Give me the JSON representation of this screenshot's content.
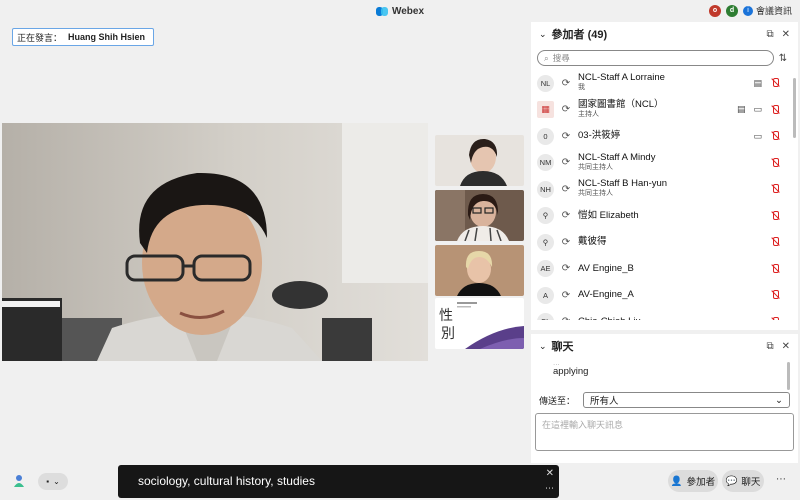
{
  "window": {
    "title": "Webex",
    "meeting_info": "會議資訊",
    "badges": [
      {
        "text": "o",
        "color": "#c0392b"
      },
      {
        "text": "d",
        "color": "#2e7d32"
      }
    ]
  },
  "speaking": {
    "label": "正在發言：",
    "name": "Huang Shih Hsien"
  },
  "participants": {
    "title": "參加者 (49)",
    "search_placeholder": "搜尋",
    "list": [
      {
        "initials": "NL",
        "name": "NCL-Staff A Lorraine",
        "role": "我",
        "cc": true,
        "camera": false
      },
      {
        "initials": "",
        "name": "國家圖書館（NCL）",
        "role": "主持人",
        "cc": true,
        "camera": true,
        "logo": true
      },
      {
        "initials": "0",
        "name": "03-洪筱婷",
        "role": "",
        "cc": false,
        "camera": true
      },
      {
        "initials": "NM",
        "name": "NCL-Staff A Mindy",
        "role": "共同主持人",
        "cc": false,
        "camera": false
      },
      {
        "initials": "NH",
        "name": "NCL-Staff B Han-yun",
        "role": "共同主持人",
        "cc": false,
        "camera": false
      },
      {
        "initials": "",
        "name": "愷如 Elizabeth",
        "role": "",
        "cc": false,
        "camera": false,
        "person": true
      },
      {
        "initials": "",
        "name": "戴彼得",
        "role": "",
        "cc": false,
        "camera": false,
        "person": true
      },
      {
        "initials": "AE",
        "name": "AV Engine_B",
        "role": "",
        "cc": false,
        "camera": false
      },
      {
        "initials": "A",
        "name": "AV-Engine_A",
        "role": "",
        "cc": false,
        "camera": false
      },
      {
        "initials": "CL",
        "name": "Chia-Chieh Liu",
        "role": "",
        "cc": false,
        "camera": false
      }
    ]
  },
  "chat": {
    "title": "聊天",
    "faded_text": "...",
    "last_message": "applying",
    "send_to_label": "傳送至：",
    "send_to_value": "所有人",
    "input_placeholder": "在這裡輸入聊天訊息"
  },
  "caption": {
    "text": "sociology, cultural history, studies"
  },
  "bottom": {
    "participants_button": "參加者",
    "chat_button": "聊天"
  },
  "colors": {
    "mic_muted": "#d22222",
    "accent": "#1a73d9"
  }
}
